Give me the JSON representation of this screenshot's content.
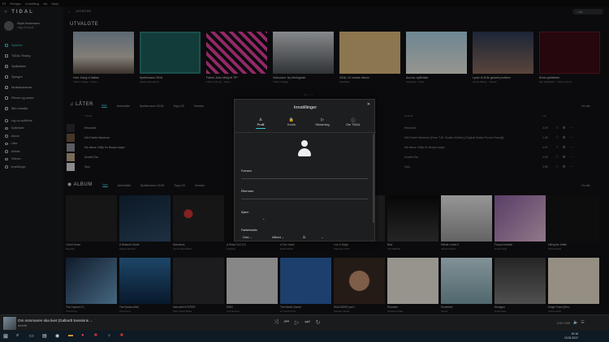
{
  "menubar": [
    "Fil",
    "Rediger",
    "Innstilling",
    "Vis",
    "Hjelp"
  ],
  "brand": {
    "dots": "⁘",
    "name": "TIDAL"
  },
  "profile": {
    "name": "Skjult brukernavn ...",
    "sub": "Legg til avspill..."
  },
  "sidebar": [
    {
      "label": "Nyheter",
      "icon": "star-icon",
      "active": true
    },
    {
      "label": "TIDAL Rising",
      "icon": "rising-icon",
      "active": false
    },
    {
      "label": "Spillelister",
      "icon": "playlist-icon",
      "active": false
    },
    {
      "label": "Sjangre",
      "icon": "genre-icon",
      "active": false
    },
    {
      "label": "Musikkvideoer",
      "icon": "video-icon",
      "active": false
    },
    {
      "label": "Filmer og serier",
      "icon": "film-icon",
      "active": false
    },
    {
      "label": "Min musikk",
      "icon": "heart-icon",
      "active": false
    }
  ],
  "sidebar_sub": [
    "Lag ny spilleliste",
    "Spillelister",
    "Album",
    "Låter",
    "Artister",
    "Videoer",
    "Innstillinger"
  ],
  "topbar": {
    "crumb": "NYHETER",
    "search_placeholder": "Søk"
  },
  "featured": {
    "title": "UTVALGTE",
    "items": [
      {
        "title": "Hver Gang vi Møtes",
        "sub": "TIDAL Utvalgt · Ukens ..."
      },
      {
        "title": "Spellemann 2016",
        "sub": "Spellemannprisen"
      },
      {
        "title": "Father John Misty til TIP",
        "sub": "TIDAL Intervju · Nyhet"
      },
      {
        "title": "Velkomen: Ny tilbringelse",
        "sub": "TIDAL Utvalgt"
      },
      {
        "title": "2016: 12 norske album",
        "sub": "Spilleliste"
      },
      {
        "title": "Aurora: spilleliste",
        "sub": "Spilleliste · Artist"
      },
      {
        "title": "Lyner et til år garanti problem",
        "sub": "Sindre Backe · Aktuelt"
      },
      {
        "title": "Årets spillelister",
        "sub": "Alle Spillelister · TIDAL på nytt"
      }
    ]
  },
  "tracks": {
    "title": "LÅTER",
    "tabs": [
      "Nye",
      "Anbefalte",
      "Spellemann 2016",
      "Topp 20",
      "Norske"
    ],
    "view_all": "Vis alle",
    "col_title": "TITTEL",
    "col_album": "ALBUM",
    "col_dur": "TID",
    "rows": [
      {
        "title": "Resolved",
        "album": "Resolved",
        "dur": "3:29"
      },
      {
        "title": "Min Første Mammon",
        "album": "Min Første Mammon (From T.W. Studios Edition) [Original Motion Picture Soundt]",
        "dur": "1:45"
      },
      {
        "title": "Me danse i Måp for illusjon dager",
        "album": "Me danse i Måp for illusjon dager",
        "dur": "4:07"
      },
      {
        "title": "Scarlet Gal",
        "album": "Scarlet Gal",
        "dur": "4:00"
      },
      {
        "title": "Solo",
        "album": "Solo",
        "dur": "3:55"
      }
    ]
  },
  "album_section": {
    "title": "ALBUM",
    "tabs": [
      "Nye",
      "Anbefalte",
      "Spellemann 2016",
      "Topp 20",
      "Norske"
    ],
    "view_all": "Vis alle",
    "row1": [
      {
        "title": "I Don't Know",
        "sub": "Dagvakt"
      },
      {
        "title": "A Seeker's Guide",
        "sub": "Sergeit Hansen"
      },
      {
        "title": "Monoform",
        "sub": "Secret Fjels Band"
      },
      {
        "title": "A Head Full Of D",
        "sub": "Coldplay"
      },
      {
        "title": "A Fire Inside",
        "sub": "Rudsi Martin"
      },
      {
        "title": "Live & Bright",
        "sub": "Stanhope Stnd"
      },
      {
        "title": "Blue",
        "sub": "Joni Mitchell"
      },
      {
        "title": "Hånde Lorem II",
        "sub": "Alpha Frankier"
      },
      {
        "title": "Fuzzy Invention",
        "sub": "Guest Nolte"
      },
      {
        "title": "Killing the Kettle",
        "sub": "Alvinde Dale"
      }
    ],
    "row2": [
      {
        "title": "The Copenh 21...",
        "sub": "Pink Floyd"
      },
      {
        "title": "The Division Bell",
        "sub": "Pink Floyd"
      },
      {
        "title": "Immortal NYS7EDT",
        "sub": "Stein Torleif Bjella"
      },
      {
        "title": "KING",
        "sub": "Jon Hopkins"
      },
      {
        "title": "The Nordic Sound",
        "sub": "2L Sound Prod"
      },
      {
        "title": "SUN NOISE part I",
        "sub": "Stephen Moore"
      },
      {
        "title": "Rumours",
        "sub": "Fleetwood Mac"
      },
      {
        "title": "Sometime",
        "sub": "Vanna"
      },
      {
        "title": "Hexagon",
        "sub": "Dead Nolte"
      },
      {
        "title": "Single Trace (Deu...",
        "sub": "Alvinde Dale"
      }
    ]
  },
  "modal": {
    "title": "Innstillinger",
    "tabs": [
      {
        "label": "Profil",
        "icon": "person-icon",
        "glyph": "♙"
      },
      {
        "label": "Konto",
        "icon": "lock-icon",
        "glyph": "🔒"
      },
      {
        "label": "Streaming",
        "icon": "play-icon",
        "glyph": "▷"
      },
      {
        "label": "Om TIDAL",
        "icon": "info-icon",
        "glyph": "ⓘ"
      }
    ],
    "fields": {
      "first": "Fornavn",
      "last": "Etternavn",
      "gender": "Kjønn",
      "birth": "Fødselsdato"
    },
    "dob": {
      "day": "Dato",
      "month": "Måned",
      "year": "År"
    }
  },
  "player": {
    "title": "Om sommaren ska livet (Gallardt Sessions ...",
    "artist": "Annelie",
    "time": "0:00 / 3:55"
  },
  "taskbar": {
    "time": "10:16",
    "date": "13.01.2017"
  },
  "colors": {
    "accent": "#3fc6d3",
    "bg": "#111214",
    "sidebar": "#18191b",
    "modal": "#1d1e20"
  }
}
